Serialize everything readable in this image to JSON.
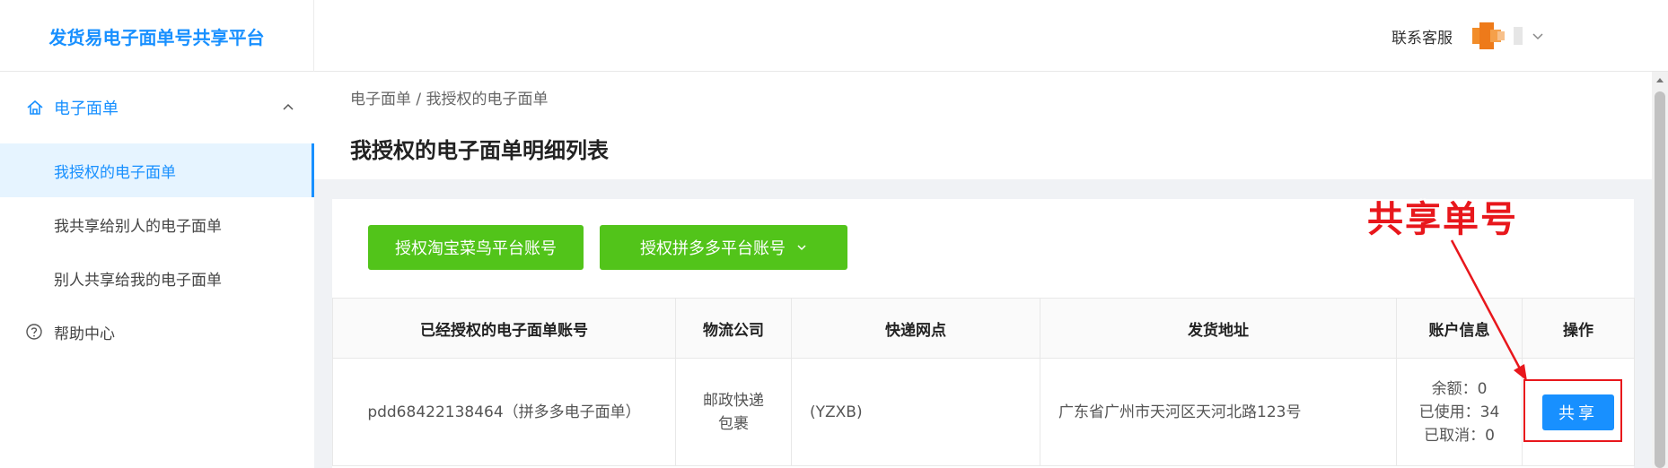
{
  "app": {
    "brand_title": "发货易电子面单号共享平台"
  },
  "header": {
    "contact": "联系客服"
  },
  "sidebar": {
    "group_label": "电子面单",
    "items": [
      {
        "label": "我授权的电子面单",
        "active": true
      },
      {
        "label": "我共享给别人的电子面单",
        "active": false
      },
      {
        "label": "别人共享给我的电子面单",
        "active": false
      }
    ],
    "help_label": "帮助中心"
  },
  "page": {
    "breadcrumb": "电子面单 / 我授权的电子面单",
    "title": "我授权的电子面单明细列表"
  },
  "actions": {
    "taobao_button": "授权淘宝菜鸟平台账号",
    "pdd_button": "授权拼多多平台账号"
  },
  "table": {
    "headers": [
      "已经授权的电子面单账号",
      "物流公司",
      "快递网点",
      "发货地址",
      "账户信息",
      "操作"
    ],
    "rows": [
      {
        "account": "pdd68422138464（拼多多电子面单）",
        "company_line1": "邮政快递",
        "company_line2": "包裹",
        "branch": "(YZXB)",
        "address": "广东省广州市天河区天河北路123号",
        "balance": "余额：0",
        "used": "已使用：34",
        "cancelled": "已取消：0",
        "action": "共享"
      }
    ]
  },
  "annotation": {
    "label": "共享单号"
  },
  "colors": {
    "brand_blue": "#1890ff",
    "action_green": "#52c41a",
    "annotation_red": "#e8171c"
  }
}
